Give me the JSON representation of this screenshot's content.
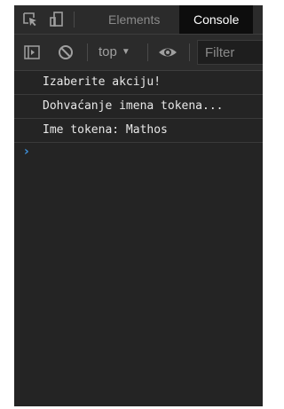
{
  "tabs": {
    "elements": "Elements",
    "console": "Console"
  },
  "toolbar": {
    "context": "top",
    "filter_placeholder": "Filter"
  },
  "console_messages": [
    "Izaberite akciju!",
    "Dohvaćanje imena tokena...",
    "Ime tokena: Mathos"
  ],
  "colors": {
    "background": "#242424",
    "tab_active_bg": "#0d0d0d",
    "prompt": "#3d8fd8"
  },
  "icons": {
    "inspect": "inspect-element-icon",
    "device": "device-toolbar-icon",
    "sidebar": "sidebar-toggle-icon",
    "clear": "clear-console-icon",
    "dropdown": "chevron-down-icon",
    "eye": "eye-icon",
    "prompt": "prompt-chevron-icon"
  }
}
